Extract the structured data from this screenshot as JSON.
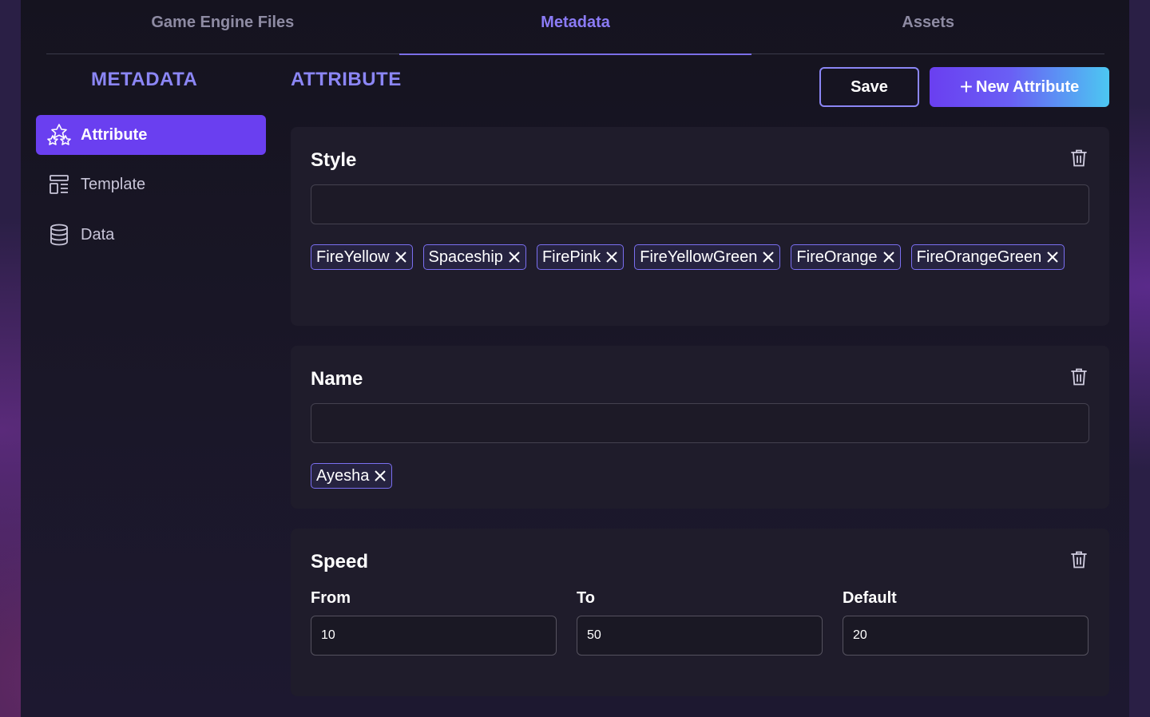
{
  "tabs": [
    {
      "label": "Game Engine Files",
      "active": false
    },
    {
      "label": "Metadata",
      "active": true
    },
    {
      "label": "Assets",
      "active": false
    }
  ],
  "sidebar": {
    "title": "METADATA",
    "items": [
      {
        "label": "Attribute",
        "icon": "shapes-icon",
        "active": true
      },
      {
        "label": "Template",
        "icon": "layout-icon",
        "active": false
      },
      {
        "label": "Data",
        "icon": "database-icon",
        "active": false
      }
    ]
  },
  "header": {
    "title": "ATTRIBUTE",
    "save_label": "Save",
    "new_label": "New Attribute"
  },
  "cards": {
    "style": {
      "title": "Style",
      "input_value": "",
      "tags": [
        "FireYellow",
        "Spaceship",
        "FirePink",
        "FireYellowGreen",
        "FireOrange",
        "FireOrangeGreen"
      ]
    },
    "name": {
      "title": "Name",
      "input_value": "",
      "tags": [
        "Ayesha"
      ]
    },
    "speed": {
      "title": "Speed",
      "from_label": "From",
      "from_value": "10",
      "to_label": "To",
      "to_value": "50",
      "default_label": "Default",
      "default_value": "20"
    }
  },
  "colors": {
    "accent": "#6a3ff0",
    "accent_text": "#8b86f5",
    "gradient_end": "#4cc7f2",
    "card_bg": "#1f1c2b"
  }
}
